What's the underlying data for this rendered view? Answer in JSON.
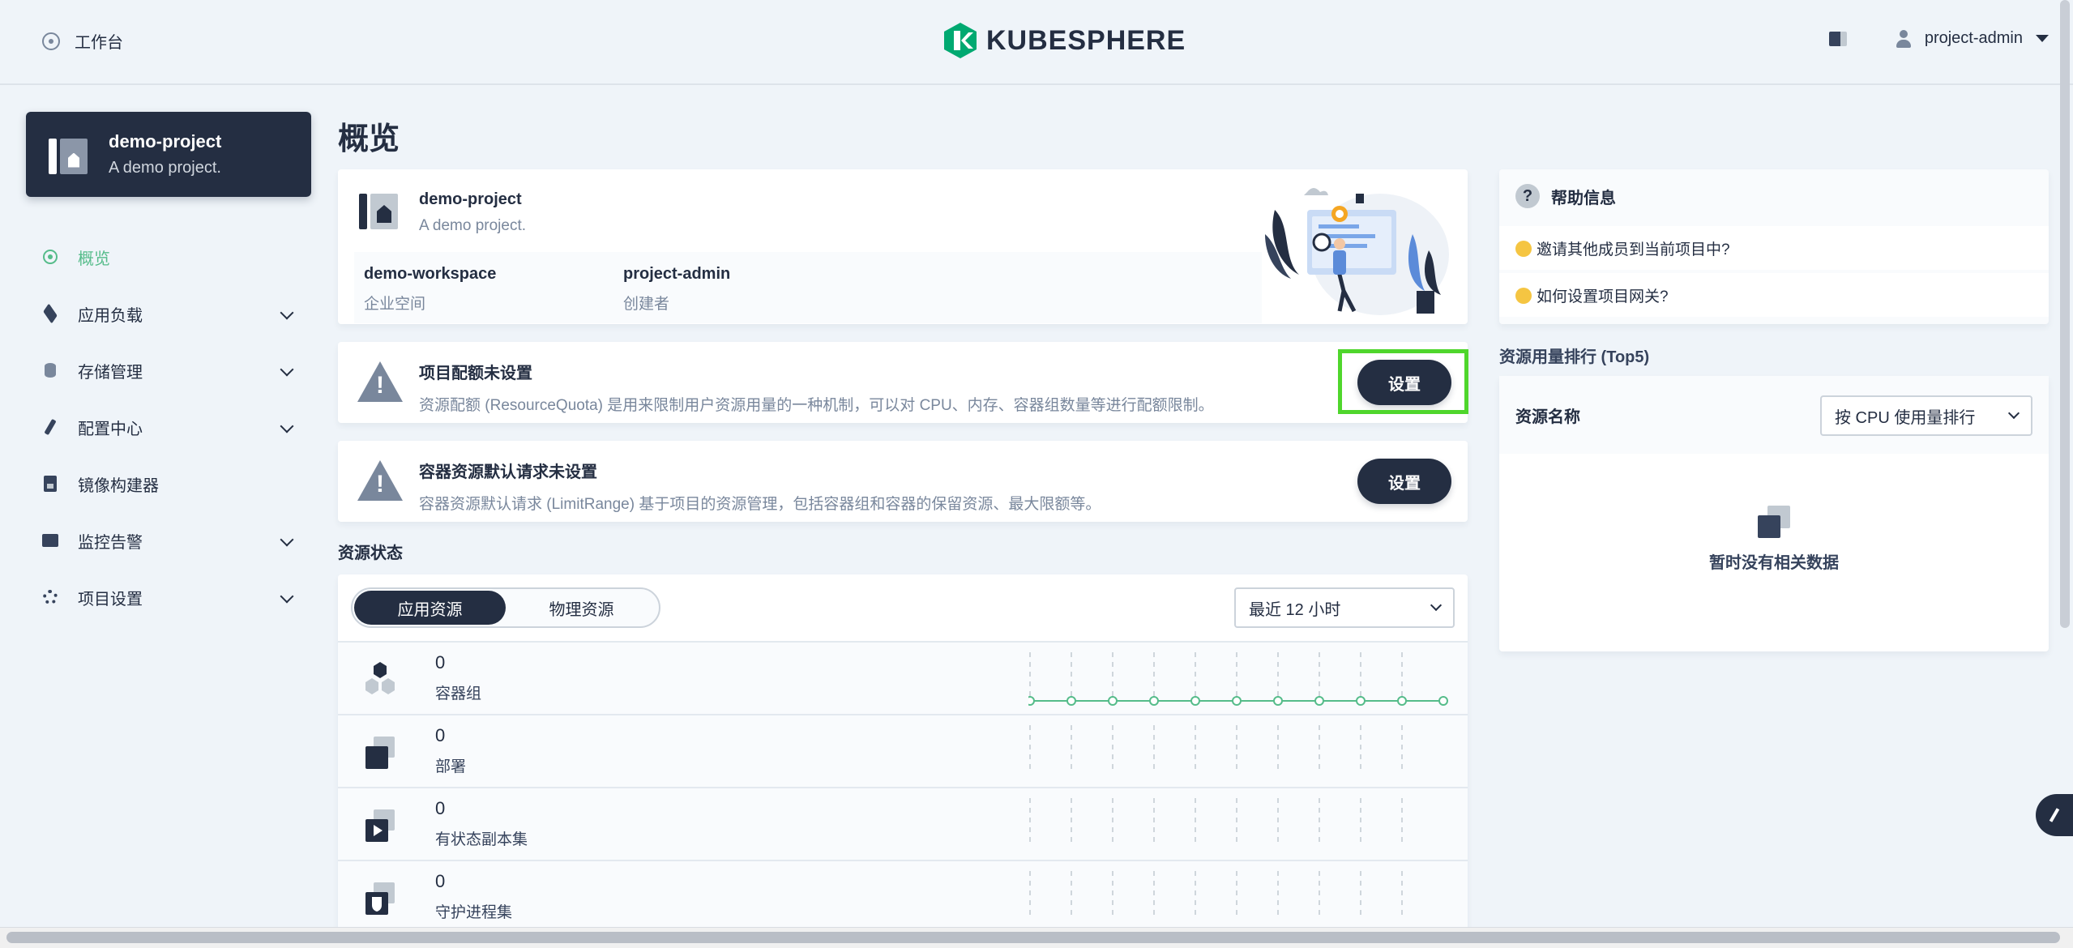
{
  "header": {
    "workbench_label": "工作台",
    "logo_text": "KUBESPHERE",
    "user_name": "project-admin"
  },
  "sidebar": {
    "project_name": "demo-project",
    "project_desc": "A demo project.",
    "items": [
      {
        "label": "概览",
        "icon": "overview-icon",
        "active": true
      },
      {
        "label": "应用负载",
        "icon": "layers-icon"
      },
      {
        "label": "存储管理",
        "icon": "database-icon"
      },
      {
        "label": "配置中心",
        "icon": "hammer-icon"
      },
      {
        "label": "镜像构建器",
        "icon": "image-builder-icon"
      },
      {
        "label": "监控告警",
        "icon": "monitor-icon"
      },
      {
        "label": "项目设置",
        "icon": "gear-icon"
      }
    ]
  },
  "main": {
    "page_title": "概览",
    "info": {
      "name": "demo-project",
      "desc": "A demo project.",
      "workspace_value": "demo-workspace",
      "workspace_label": "企业空间",
      "creator_value": "project-admin",
      "creator_label": "创建者"
    },
    "quota_alert": {
      "title": "项目配额未设置",
      "desc": "资源配额 (ResourceQuota) 是用来限制用户资源用量的一种机制，可以对 CPU、内存、容器组数量等进行配额限制。",
      "button": "设置"
    },
    "limit_alert": {
      "title": "容器资源默认请求未设置",
      "desc": "容器资源默认请求 (LimitRange) 基于项目的资源管理，包括容器组和容器的保留资源、最大限额等。",
      "button": "设置"
    },
    "resource_status": {
      "section_label": "资源状态",
      "tab_app": "应用资源",
      "tab_physical": "物理资源",
      "time_range": "最近 12 小时",
      "rows": [
        {
          "count": "0",
          "label": "容器组"
        },
        {
          "count": "0",
          "label": "部署"
        },
        {
          "count": "0",
          "label": "有状态副本集"
        },
        {
          "count": "0",
          "label": "守护进程集"
        }
      ]
    }
  },
  "right": {
    "help": {
      "title": "帮助信息",
      "items": [
        "邀请其他成员到当前项目中?",
        "如何设置项目网关?"
      ]
    },
    "ranking": {
      "title": "资源用量排行 (Top5)",
      "column_label": "资源名称",
      "sort_select": "按 CPU 使用量排行",
      "empty_text": "暂时没有相关数据"
    }
  },
  "colors": {
    "accent": "#55bc8a",
    "dark": "#242e42",
    "highlight": "#4fd62c"
  }
}
